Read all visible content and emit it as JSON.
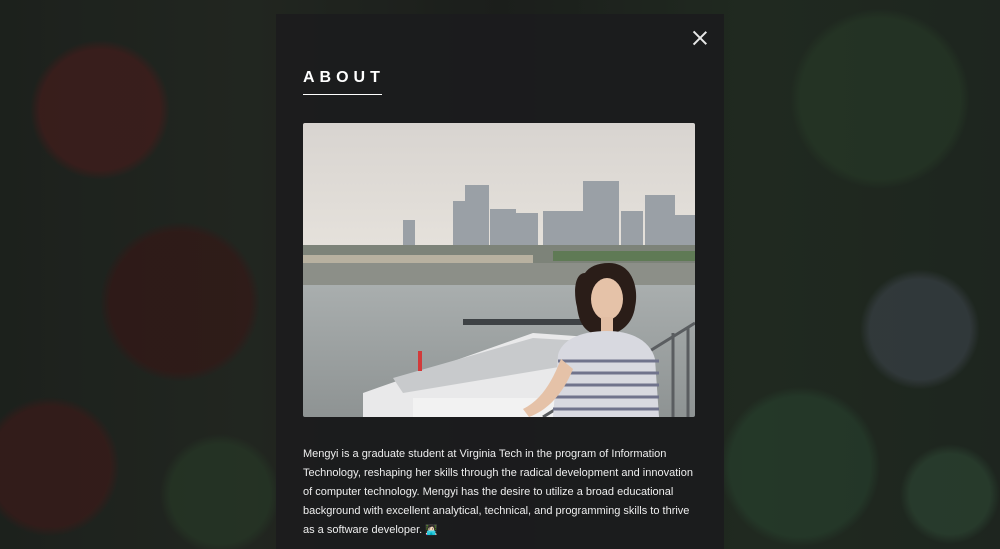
{
  "about_modal": {
    "title": "ABOUT",
    "photo_alt": "Mengyi standing on a pier with city skyline behind",
    "description": "Mengyi is a graduate student at Virginia Tech in the program of Information Technology, reshaping her skills through the radical development and innovation of computer technology. Mengyi has the desire to utilize a broad educational background with excellent analytical, technical, and programming skills to thrive as a software developer.",
    "emoji": "👩🏻‍💻",
    "close_icon": "close-icon"
  },
  "colors": {
    "modal_background": "#1c1c1e",
    "title_text": "#ffffff",
    "body_text": "#eeeeee"
  }
}
